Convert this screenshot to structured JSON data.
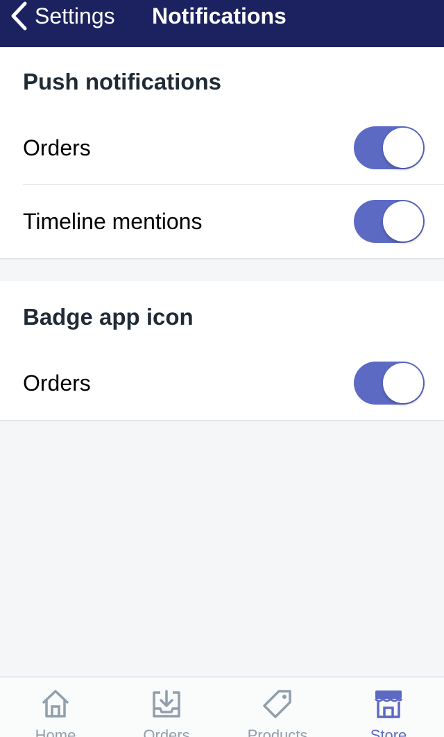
{
  "nav": {
    "back_label": "Settings",
    "title": "Notifications",
    "back_icon": "chevron-left-icon"
  },
  "push_section": {
    "title": "Push notifications",
    "rows": [
      {
        "label": "Orders",
        "toggle_on": true
      },
      {
        "label": "Timeline mentions",
        "toggle_on": true
      }
    ]
  },
  "badge_section": {
    "title": "Badge app icon",
    "rows": [
      {
        "label": "Orders",
        "toggle_on": true
      }
    ]
  },
  "tabs": [
    {
      "label": "Home",
      "icon": "home-icon",
      "active": false
    },
    {
      "label": "Orders",
      "icon": "orders-inbox-icon",
      "active": false
    },
    {
      "label": "Products",
      "icon": "tag-icon",
      "active": false
    },
    {
      "label": "Store",
      "icon": "store-icon",
      "active": true
    }
  ],
  "colors": {
    "nav_background": "#1c2260",
    "accent": "#5c6ac4",
    "page_background": "#f4f6f8",
    "inactive_tab": "#919eab"
  }
}
